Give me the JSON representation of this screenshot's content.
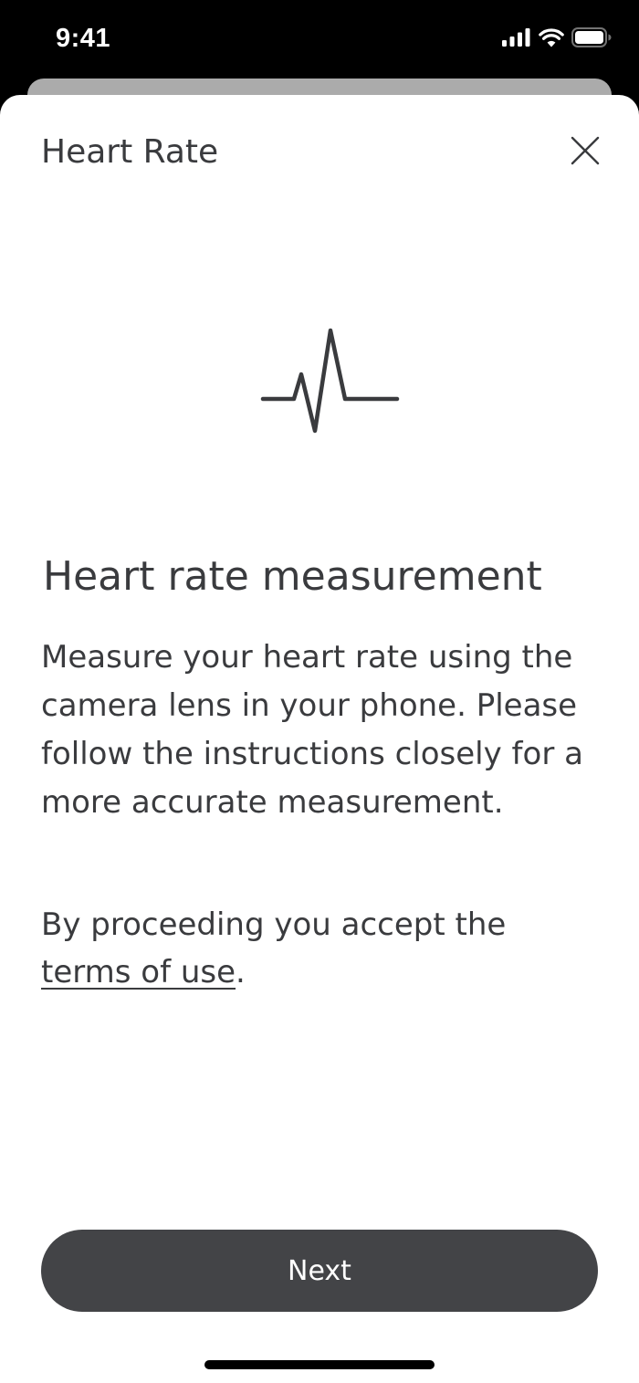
{
  "status_bar": {
    "time": "9:41",
    "icons": [
      "cellular-signal-icon",
      "wifi-icon",
      "battery-icon"
    ]
  },
  "sheet": {
    "title": "Heart Rate",
    "close_icon": "close-icon"
  },
  "illustration": {
    "icon": "heartbeat-icon"
  },
  "content": {
    "heading": "Heart rate measurement",
    "description": "Measure your heart rate using the camera lens in your phone. Please follow the instructions closely for a more accurate measurement.",
    "terms_prefix": "By proceeding you accept the",
    "terms_link": "terms of use",
    "terms_suffix": "."
  },
  "actions": {
    "next_label": "Next"
  },
  "colors": {
    "text": "#3a3b3e",
    "button_bg": "#434447",
    "sheet_bg": "#ffffff",
    "backdrop": "#000000"
  }
}
